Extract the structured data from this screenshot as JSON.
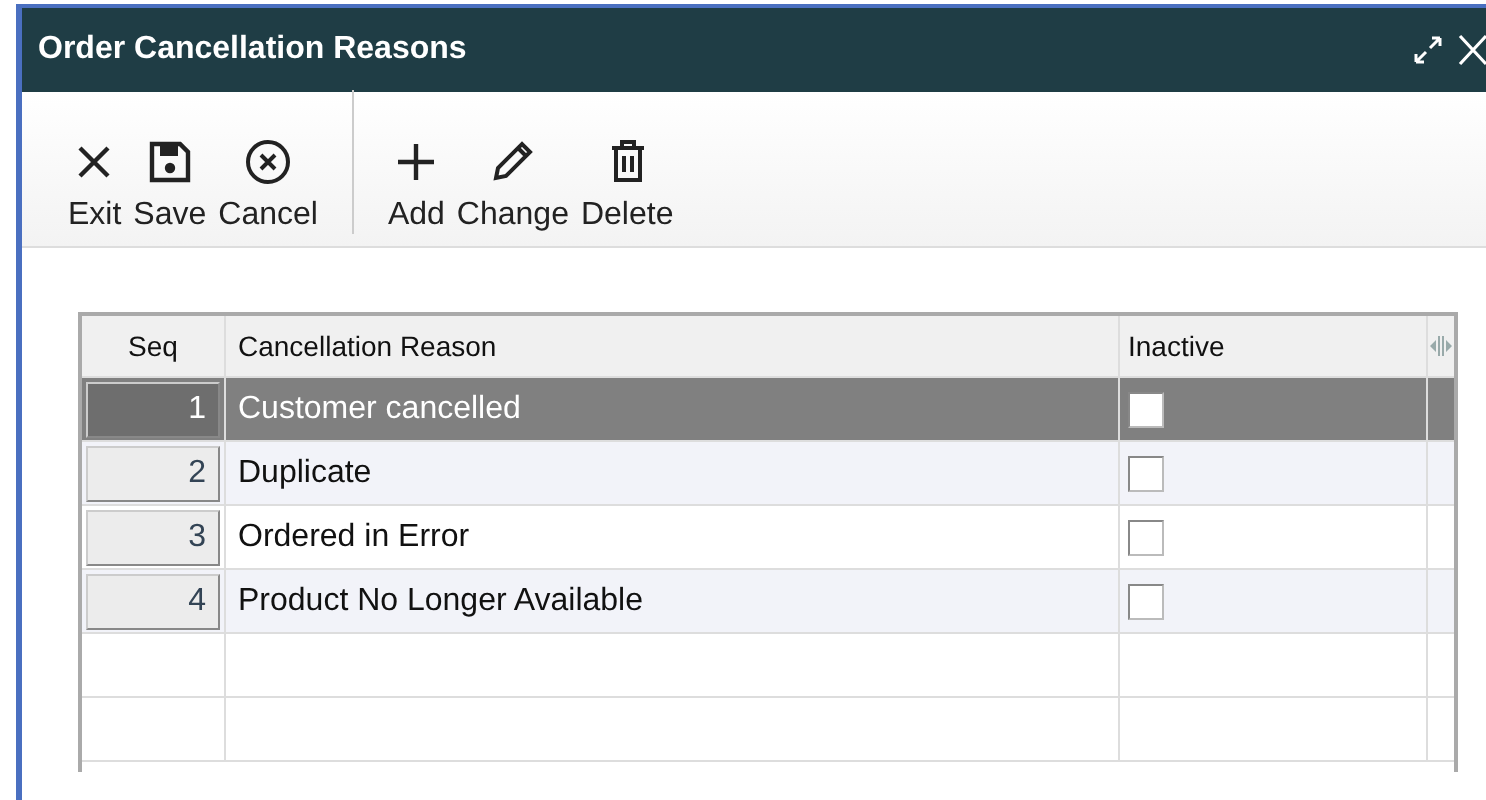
{
  "window": {
    "title": "Order Cancellation Reasons"
  },
  "toolbar": [
    {
      "kind": "exit",
      "label": "Exit"
    },
    {
      "kind": "save",
      "label": "Save"
    },
    {
      "kind": "cancel",
      "label": "Cancel"
    },
    {
      "kind": "separator"
    },
    {
      "kind": "add",
      "label": "Add"
    },
    {
      "kind": "change",
      "label": "Change"
    },
    {
      "kind": "delete",
      "label": "Delete"
    }
  ],
  "table": {
    "columns": [
      "Seq",
      "Cancellation Reason",
      "Inactive"
    ],
    "rows": [
      {
        "seq": "1",
        "reason": "Customer cancelled",
        "inactive": false,
        "selected": true
      },
      {
        "seq": "2",
        "reason": "Duplicate",
        "inactive": false,
        "selected": false
      },
      {
        "seq": "3",
        "reason": "Ordered in Error",
        "inactive": false,
        "selected": false
      },
      {
        "seq": "4",
        "reason": "Product No Longer Available",
        "inactive": false,
        "selected": false
      }
    ]
  }
}
